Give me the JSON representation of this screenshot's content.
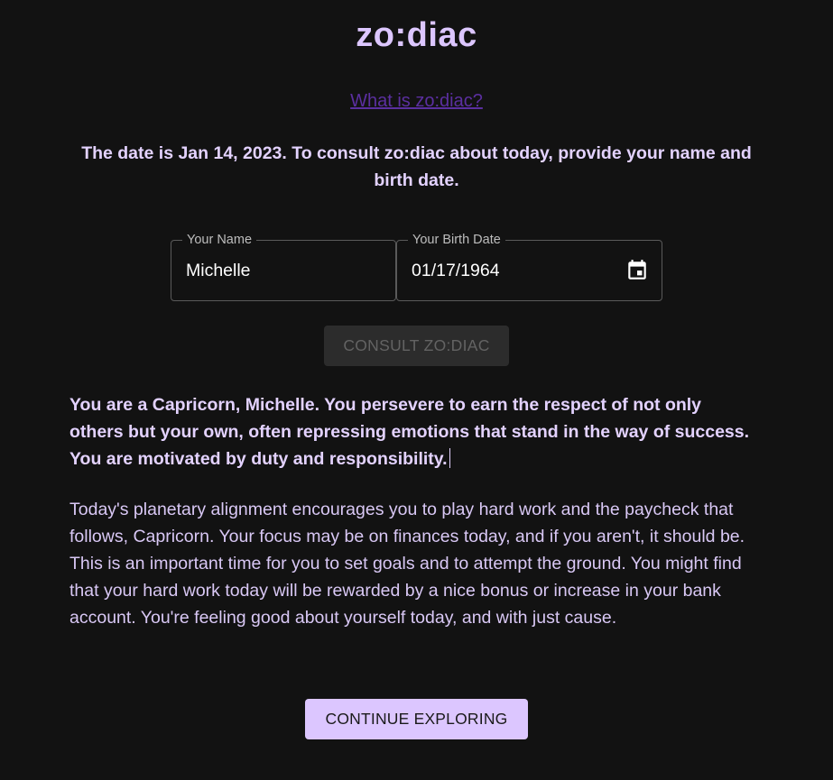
{
  "app": {
    "title": "zo:diac",
    "about_link": "What is zo:diac?"
  },
  "intro": {
    "text": "The date is Jan 14, 2023. To consult zo:diac about today, provide your name and birth date."
  },
  "form": {
    "name": {
      "label": "Your Name",
      "value": "Michelle"
    },
    "birth_date": {
      "label": "Your Birth Date",
      "value": "01/17/1964",
      "icon": "calendar-icon"
    },
    "consult_button": "CONSULT ZO:DIAC"
  },
  "result": {
    "sign_text": "You are a Capricorn, Michelle. You persevere to earn the respect of not only others but your own, often repressing emotions that stand in the way of success. You are motivated by duty and responsibility.",
    "horoscope": "Today's planetary alignment encourages you to play hard work and the paycheck that follows, Capricorn. Your focus may be on finances today, and if you aren't, it should be. This is an important time for you to set goals and to attempt the ground. You might find that your hard work today will be rewarded by a nice bonus or increase in your bank account. You're feeling good about yourself today, and with just cause.",
    "continue_button": "CONTINUE EXPLORING"
  },
  "colors": {
    "background": "#121212",
    "accent": "#dcc6ff",
    "link": "#5b2fa0",
    "disabled_button": "#2c2c2c"
  }
}
